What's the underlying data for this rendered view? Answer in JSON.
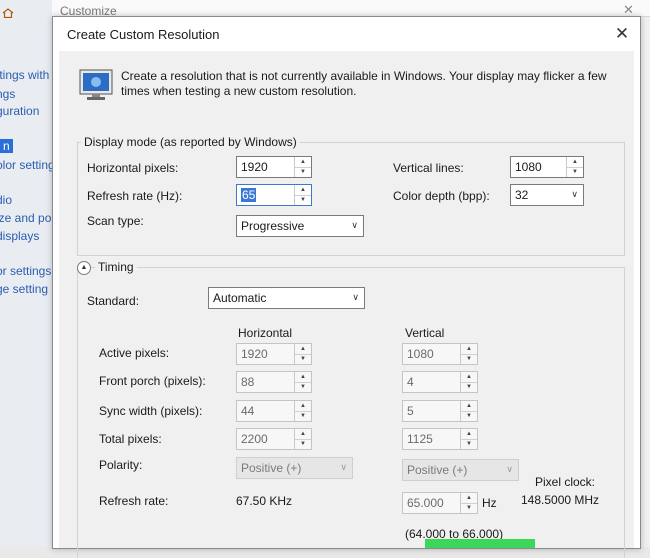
{
  "background_window": {
    "title": "Customize",
    "close": "✕",
    "left_items": [
      "ttings with",
      "ngs",
      "guration",
      "n",
      "olor setting",
      "dio",
      "ize and po",
      "displays",
      "or settings",
      "ge setting"
    ]
  },
  "dialog": {
    "title": "Create Custom Resolution",
    "close": "✕",
    "intro": "Create a resolution that is not currently available in Windows. Your display may flicker a few times when testing a new custom resolution.",
    "icon": "monitor-icon"
  },
  "display_mode": {
    "group_label": "Display mode (as reported by Windows)",
    "horizontal_pixels_label": "Horizontal pixels:",
    "horizontal_pixels": "1920",
    "vertical_lines_label": "Vertical lines:",
    "vertical_lines": "1080",
    "refresh_rate_label": "Refresh rate (Hz):",
    "refresh_rate": "65",
    "color_depth_label": "Color depth (bpp):",
    "color_depth": "32",
    "scan_type_label": "Scan type:",
    "scan_type": "Progressive"
  },
  "timing": {
    "label": "Timing",
    "standard_label": "Standard:",
    "standard": "Automatic",
    "horizontal_header": "Horizontal",
    "vertical_header": "Vertical",
    "rows": [
      {
        "label": "Active pixels:",
        "h": "1920",
        "v": "1080"
      },
      {
        "label": "Front porch (pixels):",
        "h": "88",
        "v": "4"
      },
      {
        "label": "Sync width (pixels):",
        "h": "44",
        "v": "5"
      },
      {
        "label": "Total pixels:",
        "h": "2200",
        "v": "1125"
      }
    ],
    "polarity_label": "Polarity:",
    "polarity_h": "Positive (+)",
    "polarity_v": "Positive (+)",
    "refresh_label": "Refresh rate:",
    "refresh_h": "67.50 KHz",
    "refresh_v": "65.000",
    "refresh_v_unit": "Hz",
    "refresh_range": "(64.000 to 66.000)",
    "pixel_clock_label": "Pixel clock:",
    "pixel_clock": "148.5000 MHz"
  },
  "colors": {
    "accent": "#3b77d6",
    "green_button": "#3bd65a"
  }
}
